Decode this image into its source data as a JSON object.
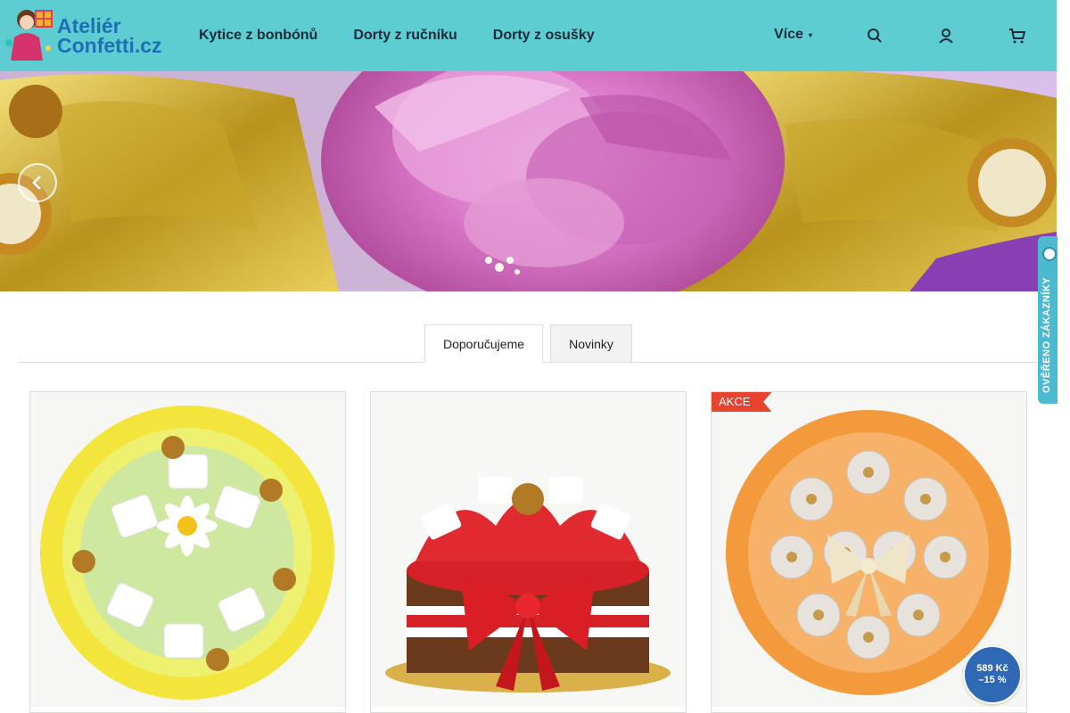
{
  "header": {
    "logo_line1": "Ateliér",
    "logo_line2": "Confetti.cz",
    "nav": [
      "Kytice z bonbónů",
      "Dorty z ručníku",
      "Dorty z osušky"
    ],
    "more_label": "Více",
    "icons": [
      "search-icon",
      "user-icon",
      "cart-icon"
    ],
    "bg_color": "#5dcdd1"
  },
  "tabs": {
    "active": "Doporučujeme",
    "inactive": "Novinky"
  },
  "products": [
    {
      "image": "raffaello-bouquet-image"
    },
    {
      "image": "chocolate-cake-image"
    },
    {
      "image": "towel-bouquet-image",
      "badge": "AKCE"
    }
  ],
  "price_bubble": {
    "price": "589 Kč",
    "discount": "–15 %"
  },
  "widget": {
    "label": "OVĚŘENO ZÁKAZNÍKY"
  }
}
